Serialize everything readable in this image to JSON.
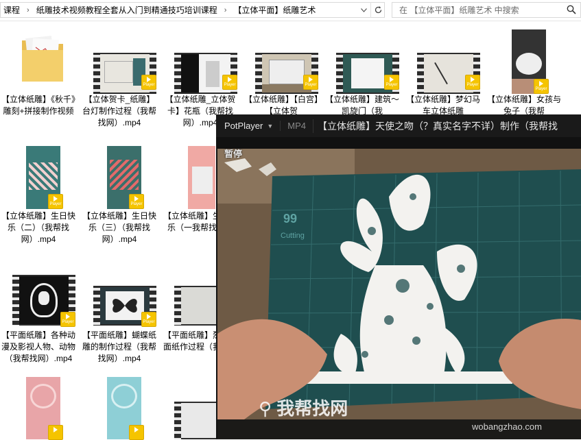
{
  "breadcrumb": {
    "items": [
      "课程",
      "纸雕技术视频教程全套从入门到精通技巧培训课程",
      "【立体平面】纸雕艺术"
    ]
  },
  "search": {
    "placeholder": "在 【立体平面】纸雕艺术 中搜索"
  },
  "player_badge": "Player",
  "files": [
    {
      "name": "【立体纸雕】《秋千》雕刻+拼接制作视频",
      "type": "folder"
    },
    {
      "name": "【立体贺卡_纸雕】台灯制作过程（我帮找网）.mp4",
      "type": "video"
    },
    {
      "name": "【立体纸雕_立体贺卡】花瓶（我帮找网）.mp4",
      "type": "video"
    },
    {
      "name": "【立体纸雕】【白宫】【立体贺",
      "type": "video"
    },
    {
      "name": "【立体纸雕】建筑～凯旋门（我",
      "type": "video"
    },
    {
      "name": "【立体纸雕】梦幻马车立体纸雕",
      "type": "video"
    },
    {
      "name": "【立体纸雕】女孩与兔子（我帮",
      "type": "video"
    },
    {
      "name": "【立体纸雕】生日快乐（二）（我帮找网）.mp4",
      "type": "video"
    },
    {
      "name": "【立体纸雕】生日快乐（三）（我帮找网）.mp4",
      "type": "video"
    },
    {
      "name": "【立体纸雕】生日快乐（一我帮找网）",
      "type": "video"
    },
    {
      "name": "【平面纸雕】各种动漫及影视人物、动物（我帮找网）.mp4",
      "type": "video"
    },
    {
      "name": "【平面纸雕】蝴蝶纸雕的制作过程（我帮找网）.mp4",
      "type": "video"
    },
    {
      "name": "【平面纸雕】烈鸟平面纸作过程（我网）",
      "type": "video"
    }
  ],
  "potplayer": {
    "app_name": "PotPlayer",
    "format": "MP4",
    "title": "【立体纸雕】天使之吻（？真实名字不详）制作（我帮找",
    "status": "暂停"
  },
  "watermark": {
    "brand": "我帮找网",
    "url": "wobangzhao.com"
  },
  "colors": {
    "player_badge": "#f5c400",
    "folder": "#f3cf6b",
    "cutting_mat": "#1f4e4f"
  }
}
